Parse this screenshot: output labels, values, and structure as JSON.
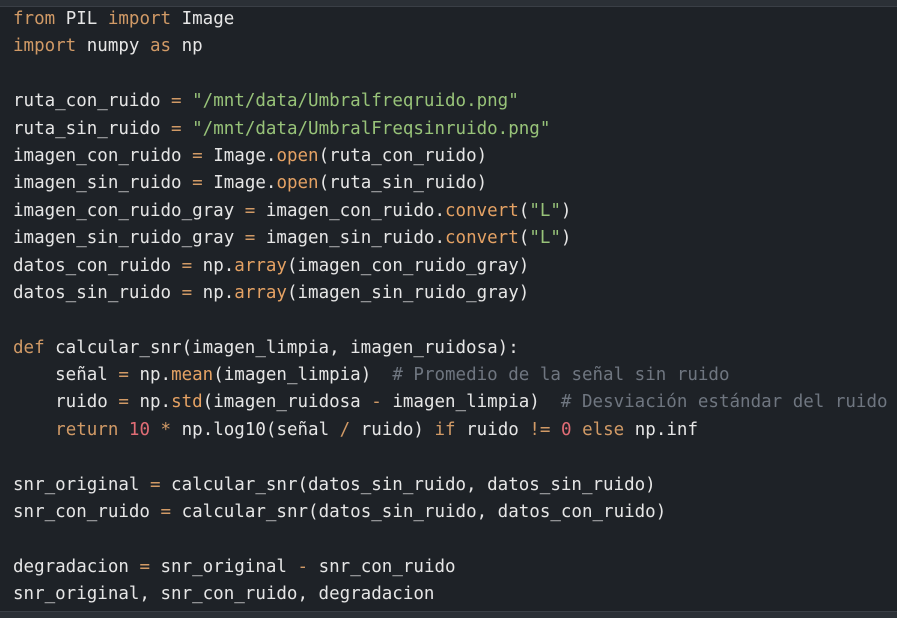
{
  "code": {
    "lines": [
      [
        {
          "t": "from",
          "c": "kw"
        },
        {
          "t": " PIL ",
          "c": "txt"
        },
        {
          "t": "import",
          "c": "kw"
        },
        {
          "t": " Image",
          "c": "txt"
        }
      ],
      [
        {
          "t": "import",
          "c": "kw"
        },
        {
          "t": " numpy ",
          "c": "txt"
        },
        {
          "t": "as",
          "c": "kw"
        },
        {
          "t": " np",
          "c": "txt"
        }
      ],
      [],
      [
        {
          "t": "ruta_con_ruido ",
          "c": "txt"
        },
        {
          "t": "=",
          "c": "op"
        },
        {
          "t": " ",
          "c": "txt"
        },
        {
          "t": "\"/mnt/data/Umbralfreqruido.png\"",
          "c": "str"
        }
      ],
      [
        {
          "t": "ruta_sin_ruido ",
          "c": "txt"
        },
        {
          "t": "=",
          "c": "op"
        },
        {
          "t": " ",
          "c": "txt"
        },
        {
          "t": "\"/mnt/data/UmbralFreqsinruido.png\"",
          "c": "str"
        }
      ],
      [
        {
          "t": "imagen_con_ruido ",
          "c": "txt"
        },
        {
          "t": "=",
          "c": "op"
        },
        {
          "t": " Image.",
          "c": "txt"
        },
        {
          "t": "open",
          "c": "fn"
        },
        {
          "t": "(ruta_con_ruido)",
          "c": "txt"
        }
      ],
      [
        {
          "t": "imagen_sin_ruido ",
          "c": "txt"
        },
        {
          "t": "=",
          "c": "op"
        },
        {
          "t": " Image.",
          "c": "txt"
        },
        {
          "t": "open",
          "c": "fn"
        },
        {
          "t": "(ruta_sin_ruido)",
          "c": "txt"
        }
      ],
      [
        {
          "t": "imagen_con_ruido_gray ",
          "c": "txt"
        },
        {
          "t": "=",
          "c": "op"
        },
        {
          "t": " imagen_con_ruido.",
          "c": "txt"
        },
        {
          "t": "convert",
          "c": "fn"
        },
        {
          "t": "(",
          "c": "txt"
        },
        {
          "t": "\"L\"",
          "c": "str"
        },
        {
          "t": ")",
          "c": "txt"
        }
      ],
      [
        {
          "t": "imagen_sin_ruido_gray ",
          "c": "txt"
        },
        {
          "t": "=",
          "c": "op"
        },
        {
          "t": " imagen_sin_ruido.",
          "c": "txt"
        },
        {
          "t": "convert",
          "c": "fn"
        },
        {
          "t": "(",
          "c": "txt"
        },
        {
          "t": "\"L\"",
          "c": "str"
        },
        {
          "t": ")",
          "c": "txt"
        }
      ],
      [
        {
          "t": "datos_con_ruido ",
          "c": "txt"
        },
        {
          "t": "=",
          "c": "op"
        },
        {
          "t": " np.",
          "c": "txt"
        },
        {
          "t": "array",
          "c": "fn"
        },
        {
          "t": "(imagen_con_ruido_gray)",
          "c": "txt"
        }
      ],
      [
        {
          "t": "datos_sin_ruido ",
          "c": "txt"
        },
        {
          "t": "=",
          "c": "op"
        },
        {
          "t": " np.",
          "c": "txt"
        },
        {
          "t": "array",
          "c": "fn"
        },
        {
          "t": "(imagen_sin_ruido_gray)",
          "c": "txt"
        }
      ],
      [],
      [
        {
          "t": "def",
          "c": "kw"
        },
        {
          "t": " calcular_snr(imagen_limpia, imagen_ruidosa):",
          "c": "txt"
        }
      ],
      [
        {
          "t": "    señal ",
          "c": "txt"
        },
        {
          "t": "=",
          "c": "op"
        },
        {
          "t": " np.",
          "c": "txt"
        },
        {
          "t": "mean",
          "c": "fn"
        },
        {
          "t": "(imagen_limpia)  ",
          "c": "txt"
        },
        {
          "t": "# Promedio de la señal sin ruido",
          "c": "cmt"
        }
      ],
      [
        {
          "t": "    ruido ",
          "c": "txt"
        },
        {
          "t": "=",
          "c": "op"
        },
        {
          "t": " np.",
          "c": "txt"
        },
        {
          "t": "std",
          "c": "fn"
        },
        {
          "t": "(imagen_ruidosa ",
          "c": "txt"
        },
        {
          "t": "-",
          "c": "op"
        },
        {
          "t": " imagen_limpia)  ",
          "c": "txt"
        },
        {
          "t": "# Desviación estándar del ruido",
          "c": "cmt"
        }
      ],
      [
        {
          "t": "    ",
          "c": "txt"
        },
        {
          "t": "return",
          "c": "kw"
        },
        {
          "t": " ",
          "c": "txt"
        },
        {
          "t": "10",
          "c": "num"
        },
        {
          "t": " ",
          "c": "txt"
        },
        {
          "t": "*",
          "c": "op"
        },
        {
          "t": " np.log10(señal ",
          "c": "txt"
        },
        {
          "t": "/",
          "c": "op"
        },
        {
          "t": " ruido) ",
          "c": "txt"
        },
        {
          "t": "if",
          "c": "kw"
        },
        {
          "t": " ruido ",
          "c": "txt"
        },
        {
          "t": "!=",
          "c": "op"
        },
        {
          "t": " ",
          "c": "txt"
        },
        {
          "t": "0",
          "c": "num"
        },
        {
          "t": " ",
          "c": "txt"
        },
        {
          "t": "else",
          "c": "kw"
        },
        {
          "t": " np.inf",
          "c": "txt"
        }
      ],
      [],
      [
        {
          "t": "snr_original ",
          "c": "txt"
        },
        {
          "t": "=",
          "c": "op"
        },
        {
          "t": " calcular_snr(datos_sin_ruido, datos_sin_ruido)",
          "c": "txt"
        }
      ],
      [
        {
          "t": "snr_con_ruido ",
          "c": "txt"
        },
        {
          "t": "=",
          "c": "op"
        },
        {
          "t": " calcular_snr(datos_sin_ruido, datos_con_ruido)",
          "c": "txt"
        }
      ],
      [],
      [
        {
          "t": "degradacion ",
          "c": "txt"
        },
        {
          "t": "=",
          "c": "op"
        },
        {
          "t": " snr_original ",
          "c": "txt"
        },
        {
          "t": "-",
          "c": "op"
        },
        {
          "t": " snr_con_ruido",
          "c": "txt"
        }
      ],
      [
        {
          "t": "snr_original, snr_con_ruido, degradacion",
          "c": "txt"
        }
      ]
    ]
  },
  "colors": {
    "background": "#1e2227",
    "keyword": "#d19a66",
    "string": "#98c379",
    "number": "#e06c75",
    "comment": "#6f7680",
    "text": "#e6e6e6"
  }
}
